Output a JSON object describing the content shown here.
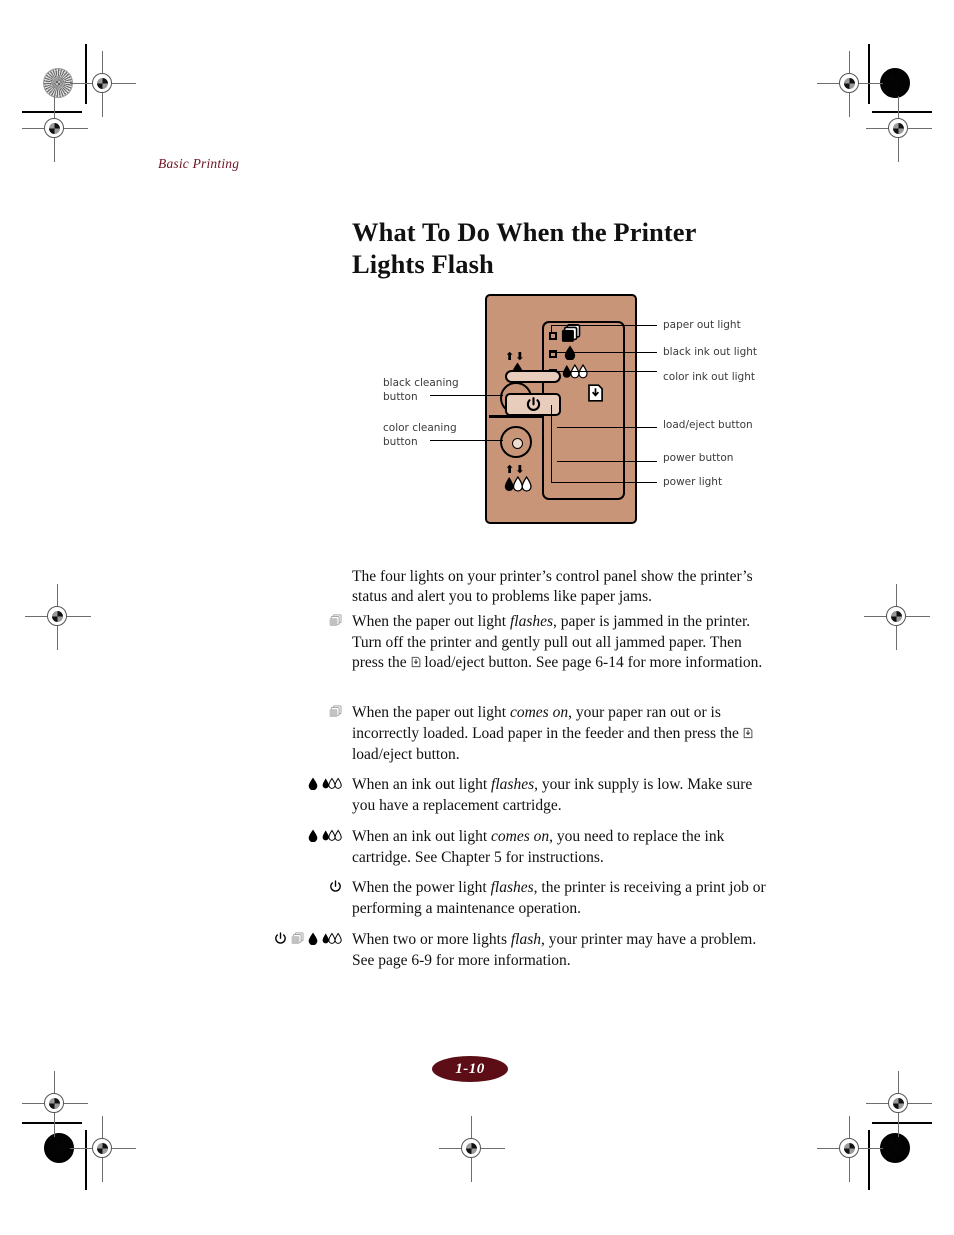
{
  "running_head": "Basic Printing",
  "title": "What To Do When the Printer Lights Flash",
  "figure": {
    "callouts": {
      "paper_out_light": "paper out light",
      "black_ink_out_light": "black ink out light",
      "color_ink_out_light": "color ink out light",
      "load_eject_button": "load/eject button",
      "power_button": "power button",
      "power_light": "power light",
      "black_cleaning_button": "black cleaning\nbutton",
      "black_cleaning_button_l1": "black cleaning",
      "black_cleaning_button_l2": "button",
      "color_cleaning_button_l1": "color cleaning",
      "color_cleaning_button_l2": "button"
    },
    "colors": {
      "panel": "#C99578",
      "button_face": "#E8CDBC",
      "outline": "#000000"
    },
    "icons": {
      "paper_stack": "paper-stack-icon",
      "black_drop": "black-ink-drop-icon",
      "color_drops": "color-ink-drops-icon",
      "load_eject": "page-eject-icon",
      "power": "power-symbol-icon",
      "updown_arrows": "up-down-arrows-icon"
    }
  },
  "intro": "The four lights on your printer’s control panel show the printer’s status and alert you to problems like paper jams.",
  "bullets": [
    {
      "icons": [
        "paper-stack-icon"
      ],
      "html": "When the paper out light <i>flashes</i>, paper is jammed in the printer. Turn off the printer and gently pull out all jammed paper. Then press the ■ load/eject button. See page 6-14 for more information."
    },
    {
      "icons": [
        "paper-stack-icon"
      ],
      "html": "When the paper out light <i>comes on</i>, your paper ran out or is incorrectly loaded. Load paper in the feeder and then press the ■ load/eject button."
    },
    {
      "icons": [
        "black-ink-drop-icon",
        "color-ink-drops-icon"
      ],
      "html": "When an ink out light <i>flashes</i>, your ink supply is low. Make sure you have a replacement cartridge."
    },
    {
      "icons": [
        "black-ink-drop-icon",
        "color-ink-drops-icon"
      ],
      "html": "When an ink out light <i>comes on</i>, you need to replace the ink cartridge. See Chapter 5 for instructions."
    },
    {
      "icons": [
        "power-symbol-icon"
      ],
      "html": "When the power light <i>flashes</i>, the printer is receiving a print job or performing a maintenance operation."
    },
    {
      "icons": [
        "power-symbol-icon",
        "paper-stack-icon",
        "black-ink-drop-icon",
        "color-ink-drops-icon"
      ],
      "html": "When two or more lights <i>flash</i>, your printer may have a problem. See page 6-9 for more information."
    }
  ],
  "page_number": "1-10"
}
